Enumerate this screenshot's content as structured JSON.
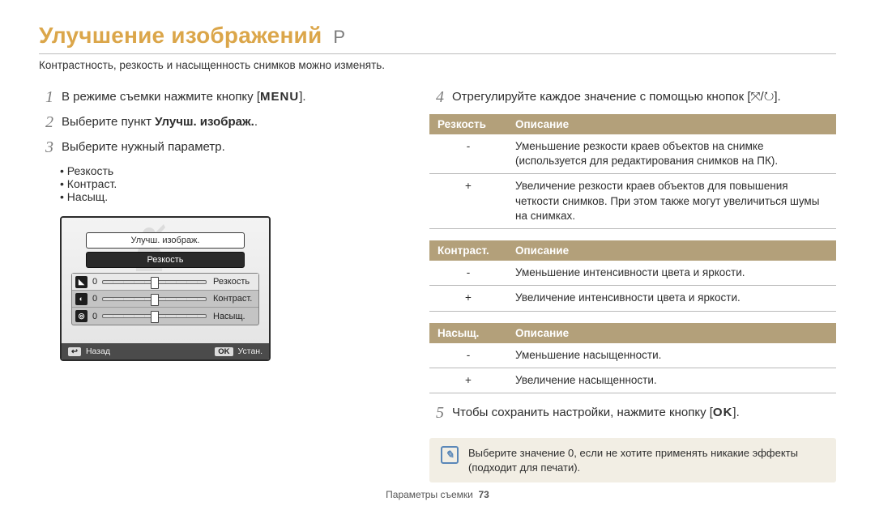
{
  "header": {
    "title": "Улучшение изображений",
    "mode": "P",
    "subtitle": "Контрастность, резкость и насыщенность снимков можно изменять."
  },
  "steps": {
    "s1_pre": "В режиме съемки нажмите кнопку [",
    "s1_menu": "MENU",
    "s1_post": "].",
    "s2_pre": "Выберите пункт ",
    "s2_bold": "Улучш. изображ.",
    "s2_post": ".",
    "s3": "Выберите нужный параметр.",
    "bullets": [
      "Резкость",
      "Контраст.",
      "Насыщ."
    ],
    "s4": "Отрегулируйте каждое значение с помощью кнопок [⤧/↻].",
    "s5_pre": "Чтобы сохранить настройки, нажмите кнопку [",
    "s5_ok": "OK",
    "s5_post": "]."
  },
  "screen": {
    "menu_label": "Улучш. изображ.",
    "active_title": "Резкость",
    "rows": [
      {
        "icon": "◣",
        "val": "0",
        "label": "Резкость"
      },
      {
        "icon": "◐",
        "val": "0",
        "label": "Контраст."
      },
      {
        "icon": "◎",
        "val": "0",
        "label": "Насыщ."
      }
    ],
    "back_key": "↩",
    "back_label": "Назад",
    "set_key": "OK",
    "set_label": "Устан."
  },
  "tables": [
    {
      "h1": "Резкость",
      "h2": "Описание",
      "rows": [
        {
          "k": "-",
          "v": "Уменьшение резкости краев объектов на снимке (используется для редактирования снимков на ПК)."
        },
        {
          "k": "+",
          "v": "Увеличение резкости краев объектов для повышения четкости снимков. При этом также могут увеличиться шумы на снимках."
        }
      ]
    },
    {
      "h1": "Контраст.",
      "h2": "Описание",
      "rows": [
        {
          "k": "-",
          "v": "Уменьшение интенсивности цвета и яркости."
        },
        {
          "k": "+",
          "v": "Увеличение интенсивности цвета и яркости."
        }
      ]
    },
    {
      "h1": "Насыщ.",
      "h2": "Описание",
      "rows": [
        {
          "k": "-",
          "v": "Уменьшение насыщенности."
        },
        {
          "k": "+",
          "v": "Увеличение насыщенности."
        }
      ]
    }
  ],
  "note": "Выберите значение 0, если не хотите применять никакие эффекты (подходит для печати).",
  "footer": {
    "section": "Параметры съемки",
    "page": "73"
  }
}
